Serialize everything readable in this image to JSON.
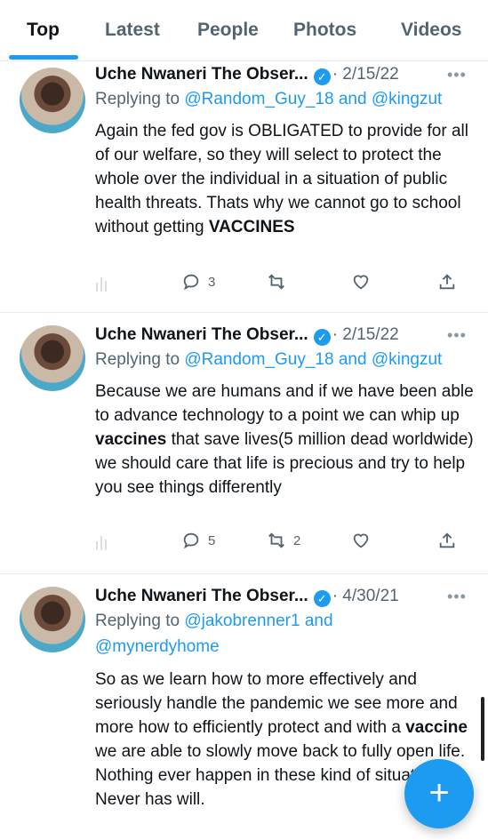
{
  "tabs": [
    "Top",
    "Latest",
    "People",
    "Photos",
    "Videos"
  ],
  "tweets": [
    {
      "name": "Uche Nwaneri The Obser...",
      "date": "· 2/15/22",
      "reply_prefix": "Replying to",
      "handles_line1": "@Random_Guy_18 and @kingzut",
      "handles_line2": "",
      "body_parts": [
        "Again the fed gov is OBLIGATED to provide for all of our welfare, so they will select to protect the whole over the individual in a situation of public health threats. Thats why we cannot go to school without getting ",
        "VACCINES",
        ""
      ],
      "replies": "3",
      "retweets": "",
      "likes": ""
    },
    {
      "name": "Uche Nwaneri The Obser...",
      "date": "· 2/15/22",
      "reply_prefix": "Replying to",
      "handles_line1": "@Random_Guy_18 and @kingzut",
      "handles_line2": "",
      "body_parts": [
        "Because we are humans and if we have been able to advance technology to a point we can whip up ",
        "vaccines",
        " that save lives(5 million dead worldwide) we should care that life is precious and try to help you see things differently"
      ],
      "replies": "5",
      "retweets": "2",
      "likes": ""
    },
    {
      "name": "Uche Nwaneri The Obser...",
      "date": "· 4/30/21",
      "reply_prefix": "Replying to",
      "handles_line1": "@jakobrenner1 and",
      "handles_line2": "@mynerdyhome",
      "body_parts": [
        "So as we learn how to more effectively and seriously handle the pandemic we see more and more how to efficiently protect and with a ",
        "vaccine",
        " we are able to slowly move back to fully open life. Nothing ever happen in these kind of situations. Never has will."
      ],
      "replies": "",
      "retweets": "",
      "likes": ""
    }
  ],
  "fab_label": "+",
  "colors": {
    "accent": "#1d9bf0",
    "text": "#0f1419",
    "muted": "#536471"
  }
}
